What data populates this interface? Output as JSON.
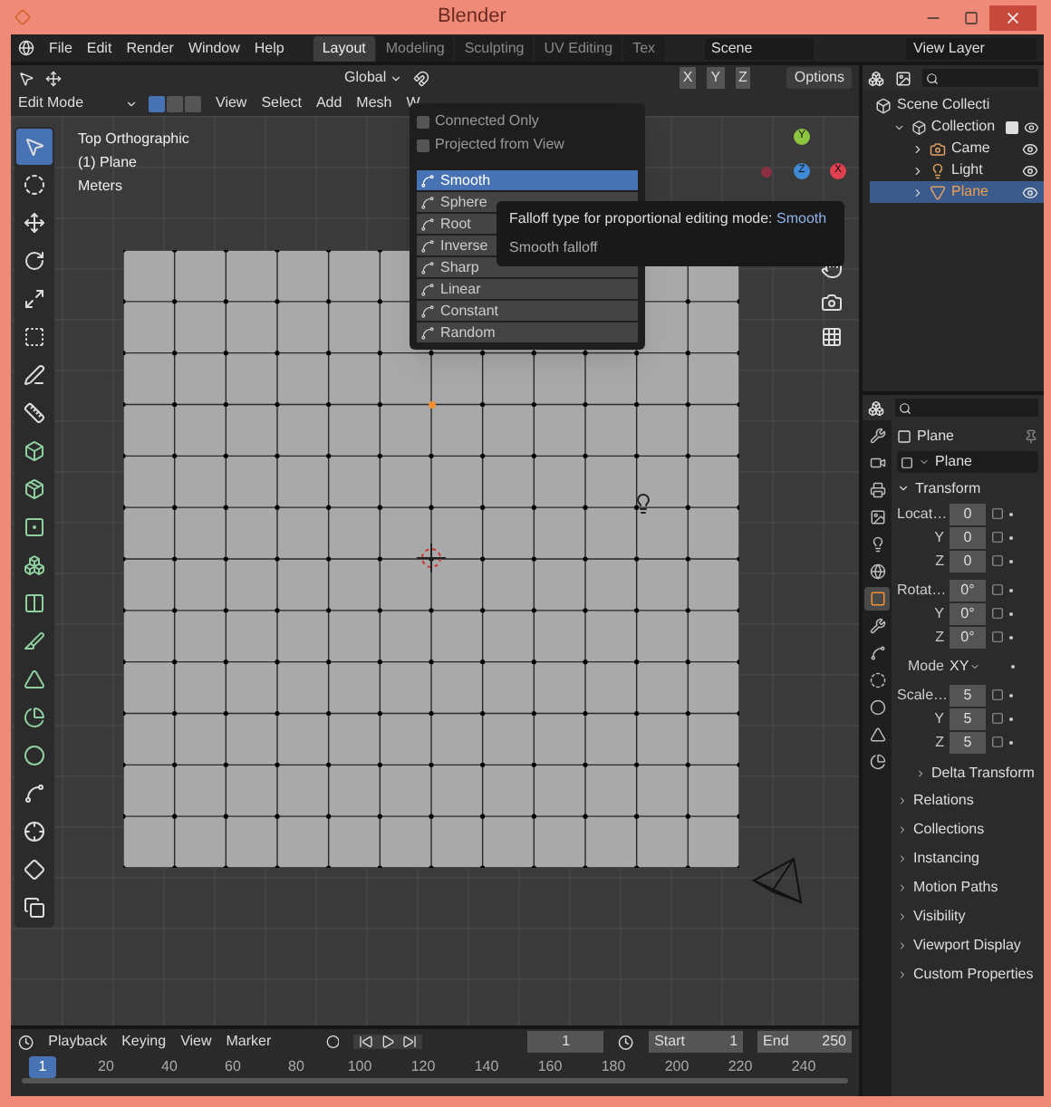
{
  "window": {
    "title": "Blender"
  },
  "menu_bar": {
    "items": [
      "File",
      "Edit",
      "Render",
      "Window",
      "Help"
    ],
    "workspace_tabs": [
      {
        "label": "Layout",
        "selected": true
      },
      {
        "label": "Modeling",
        "selected": false
      },
      {
        "label": "Sculpting",
        "selected": false
      },
      {
        "label": "UV Editing",
        "selected": false
      },
      {
        "label": "Tex",
        "selected": false
      }
    ],
    "scene": "Scene",
    "view_layer": "View Layer"
  },
  "viewport": {
    "header": {
      "orientation": "Global",
      "axes": [
        "X",
        "Y",
        "Z"
      ],
      "options": "Options",
      "mode": "Edit Mode",
      "menus": [
        "View",
        "Select",
        "Add",
        "Mesh",
        "W"
      ],
      "select_modes": [
        {
          "selected": true
        },
        {
          "selected": false
        },
        {
          "selected": false
        }
      ]
    },
    "overlay_text": [
      "Top Orthographic",
      "(1) Plane",
      "Meters"
    ],
    "tools": [
      {
        "selected": true
      },
      {
        "selected": false
      },
      {
        "selected": false
      },
      {
        "selected": false
      },
      {
        "selected": false
      },
      {
        "selected": false
      },
      {
        "selected": false
      },
      {
        "selected": false
      },
      {
        "selected": false
      },
      {
        "selected": false
      },
      {
        "selected": false
      },
      {
        "selected": false
      },
      {
        "selected": false
      },
      {
        "selected": false
      },
      {
        "selected": false
      },
      {
        "selected": false
      },
      {
        "selected": false
      },
      {
        "selected": false
      },
      {
        "selected": false
      },
      {
        "selected": false
      },
      {
        "selected": false
      }
    ],
    "gizmo_axes": [
      "Y",
      "Z",
      "X"
    ],
    "falloff_menu": {
      "toggles": [
        {
          "label": "Connected Only",
          "checked": false
        },
        {
          "label": "Projected from View",
          "checked": false
        }
      ],
      "items": [
        {
          "label": "Smooth",
          "selected": true
        },
        {
          "label": "Sphere",
          "selected": false
        },
        {
          "label": "Root",
          "selected": false
        },
        {
          "label": "Inverse",
          "selected": false
        },
        {
          "label": "Sharp",
          "selected": false
        },
        {
          "label": "Linear",
          "selected": false
        },
        {
          "label": "Constant",
          "selected": false
        },
        {
          "label": "Random",
          "selected": false
        }
      ]
    },
    "tooltip": {
      "text": "Falloff type for proportional editing mode:",
      "value": "Smooth",
      "description": "Smooth falloff"
    }
  },
  "outliner": {
    "tree": [
      {
        "label": "Scene Collecti",
        "kind": "scene",
        "selected": false,
        "children": [
          {
            "label": "Collection",
            "kind": "collection",
            "selected": false,
            "checked": true,
            "expanded": true,
            "children": [
              {
                "label": "Came",
                "kind": "camera",
                "selected": false
              },
              {
                "label": "Light",
                "kind": "light",
                "selected": false
              },
              {
                "label": "Plane",
                "kind": "mesh",
                "selected": true
              }
            ]
          }
        ]
      }
    ]
  },
  "properties": {
    "object_name": "Plane",
    "data_name": "Plane",
    "tabs": [
      {
        "selected": false
      },
      {
        "selected": false
      },
      {
        "selected": false
      },
      {
        "selected": false
      },
      {
        "selected": false
      },
      {
        "selected": false
      },
      {
        "selected": true
      },
      {
        "selected": false
      },
      {
        "selected": false
      },
      {
        "selected": false
      },
      {
        "selected": false
      },
      {
        "selected": false
      },
      {
        "selected": false
      }
    ],
    "transform": {
      "title": "Transform",
      "expanded": true,
      "rows": [
        {
          "label": "Locat…",
          "value": "0",
          "kind": "number"
        },
        {
          "label": "Y",
          "value": "0",
          "kind": "number"
        },
        {
          "label": "Z",
          "value": "0",
          "kind": "number"
        },
        {
          "label": "Rotat…",
          "value": "0°",
          "kind": "number"
        },
        {
          "label": "Y",
          "value": "0°",
          "kind": "number"
        },
        {
          "label": "Z",
          "value": "0°",
          "kind": "number"
        },
        {
          "label": "Mode",
          "value": "XY",
          "kind": "dropdown"
        },
        {
          "label": "Scale…",
          "value": "5",
          "kind": "number"
        },
        {
          "label": "Y",
          "value": "5",
          "kind": "number"
        },
        {
          "label": "Z",
          "value": "5",
          "kind": "number"
        }
      ]
    },
    "subpanel": {
      "title": "Delta Transform",
      "expanded": false
    },
    "panels": [
      {
        "title": "Relations",
        "expanded": false
      },
      {
        "title": "Collections",
        "expanded": false
      },
      {
        "title": "Instancing",
        "expanded": false
      },
      {
        "title": "Motion Paths",
        "expanded": false
      },
      {
        "title": "Visibility",
        "expanded": false
      },
      {
        "title": "Viewport Display",
        "expanded": false
      },
      {
        "title": "Custom Properties",
        "expanded": false
      }
    ]
  },
  "timeline": {
    "menus": [
      "Playback",
      "Keying",
      "View",
      "Marker"
    ],
    "current_frame": "1",
    "start_label": "Start",
    "start": "1",
    "end_label": "End",
    "end": "250",
    "ruler": [
      {
        "label": "1",
        "selected": true
      },
      {
        "label": "20",
        "selected": false
      },
      {
        "label": "40",
        "selected": false
      },
      {
        "label": "60",
        "selected": false
      },
      {
        "label": "80",
        "selected": false
      },
      {
        "label": "100",
        "selected": false
      },
      {
        "label": "120",
        "selected": false
      },
      {
        "label": "140",
        "selected": false
      },
      {
        "label": "160",
        "selected": false
      },
      {
        "label": "180",
        "selected": false
      },
      {
        "label": "200",
        "selected": false
      },
      {
        "label": "220",
        "selected": false
      },
      {
        "label": "240",
        "selected": false
      }
    ]
  }
}
